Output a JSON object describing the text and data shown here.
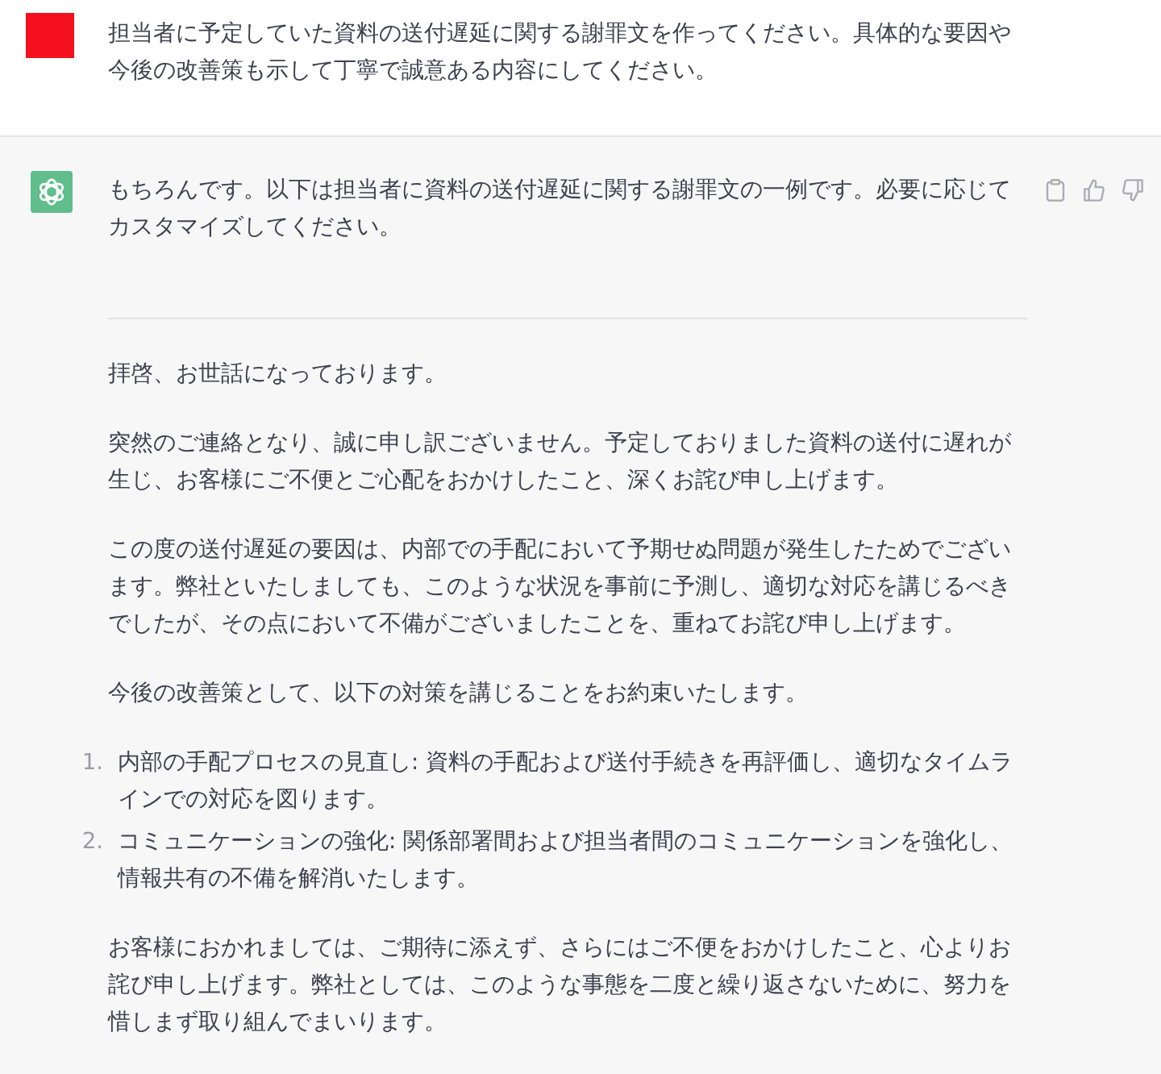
{
  "messages": [
    {
      "kind": "user",
      "text": "担当者に予定していた資料の送付遅延に関する謝罪文を作ってください。具体的な要因や今後の改善策も示して丁寧で誠意ある内容にしてください。"
    },
    {
      "kind": "assistant",
      "blocks": [
        {
          "kind": "paragraph",
          "text": "もちろんです。以下は担当者に資料の送付遅延に関する謝罪文の一例です。必要に応じてカスタマイズしてください。"
        },
        {
          "kind": "rule"
        },
        {
          "kind": "paragraph",
          "text": "拝啓、お世話になっております。"
        },
        {
          "kind": "paragraph",
          "text": "突然のご連絡となり、誠に申し訳ございません。予定しておりました資料の送付に遅れが生じ、お客様にご不便とご心配をおかけしたこと、深くお詫び申し上げます。"
        },
        {
          "kind": "paragraph",
          "text": "この度の送付遅延の要因は、内部での手配において予期せぬ問題が発生したためでございます。弊社といたしましても、このような状況を事前に予測し、適切な対応を講じるべきでしたが、その点において不備がございましたことを、重ねてお詫び申し上げます。"
        },
        {
          "kind": "paragraph",
          "text": "今後の改善策として、以下の対策を講じることをお約束いたします。"
        },
        {
          "kind": "list",
          "items": [
            {
              "number": "1.",
              "text": "内部の手配プロセスの見直し: 資料の手配および送付手続きを再評価し、適切なタイムラインでの対応を図ります。"
            },
            {
              "number": "2.",
              "text": "コミュニケーションの強化: 関係部署間および担当者間のコミュニケーションを強化し、情報共有の不備を解消いたします。"
            }
          ]
        },
        {
          "kind": "paragraph",
          "text": "お客様におかれましては、ご期待に添えず、さらにはご不便をおかけしたこと、心よりお詫び申し上げます。弊社としては、このような事態を二度と繰り返さないために、努力を惜しまず取り組んでまいります。"
        }
      ]
    }
  ]
}
